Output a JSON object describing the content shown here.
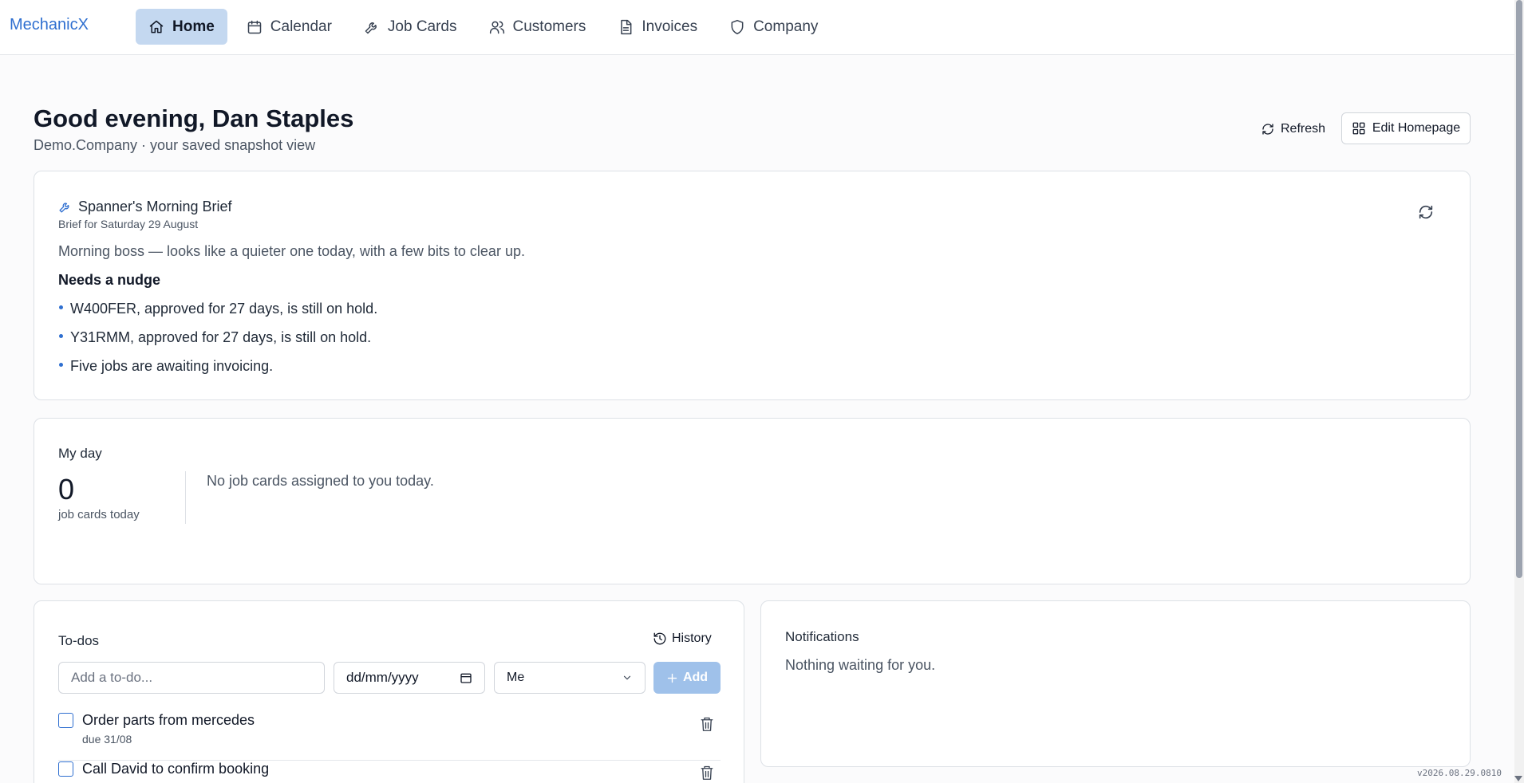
{
  "app": {
    "brand": "MechanicX",
    "version": "v2026.08.29.0810"
  },
  "nav": {
    "items": [
      {
        "label": "Home",
        "icon": "home-icon",
        "active": true
      },
      {
        "label": "Calendar",
        "icon": "calendar-icon"
      },
      {
        "label": "Job Cards",
        "icon": "wrench-icon"
      },
      {
        "label": "Customers",
        "icon": "users-icon"
      },
      {
        "label": "Invoices",
        "icon": "document-icon"
      },
      {
        "label": "Company",
        "icon": "shield-icon"
      }
    ]
  },
  "header": {
    "greeting": "Good evening, Dan Staples",
    "subtitle": "Demo.Company · your saved snapshot view",
    "refresh_label": "Refresh",
    "edit_label": "Edit Homepage"
  },
  "brief": {
    "title": "Spanner's Morning Brief",
    "date": "Brief for Saturday 29 August",
    "intro": "Morning boss — looks like a quieter one today, with a few bits to clear up.",
    "section": "Needs a nudge",
    "items": [
      "W400FER, approved for 27 days, is still on hold.",
      "Y31RMM, approved for 27 days, is still on hold.",
      "Five jobs are awaiting invoicing."
    ]
  },
  "myday": {
    "title": "My day",
    "count": "0",
    "count_label": "job cards today",
    "empty": "No job cards assigned to you today."
  },
  "todos": {
    "title": "To-dos",
    "history_label": "History",
    "input_placeholder": "Add a to-do...",
    "date_placeholder": "dd/mm/yyyy",
    "assignee": "Me",
    "add_label": "Add",
    "items": [
      {
        "label": "Order parts from mercedes",
        "due": "due 31/08"
      },
      {
        "label": "Call David to confirm booking",
        "due": ""
      }
    ]
  },
  "notifications": {
    "title": "Notifications",
    "empty": "Nothing waiting for you."
  },
  "colors": {
    "accent": "#2f6fd0",
    "nav_active": "#c4d8f0",
    "add_button": "#9fc1ea"
  }
}
